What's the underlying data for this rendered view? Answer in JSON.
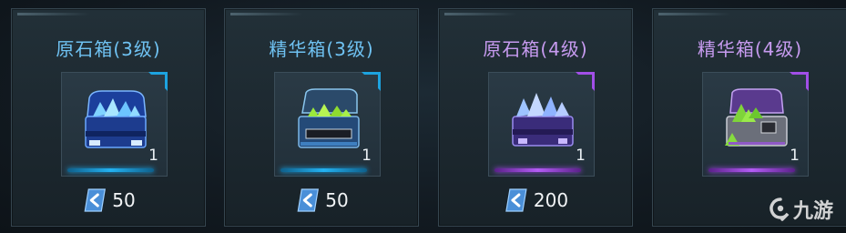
{
  "items": [
    {
      "name": "原石箱(3级)",
      "quantity": "1",
      "price": "50",
      "tier_color": "#6fc2f2",
      "icon": "ore-chest-icon"
    },
    {
      "name": "精华箱(3级)",
      "quantity": "1",
      "price": "50",
      "tier_color": "#6fc2f2",
      "icon": "essence-chest-icon"
    },
    {
      "name": "原石箱(4级)",
      "quantity": "1",
      "price": "200",
      "tier_color": "#c79bf0",
      "icon": "ore-chest-icon"
    },
    {
      "name": "精华箱(4级)",
      "quantity": "1",
      "price": "",
      "tier_color": "#c79bf0",
      "icon": "essence-chest-icon"
    }
  ],
  "currency_icon": "currency-chevron-icon",
  "watermark": {
    "text": "九游"
  }
}
